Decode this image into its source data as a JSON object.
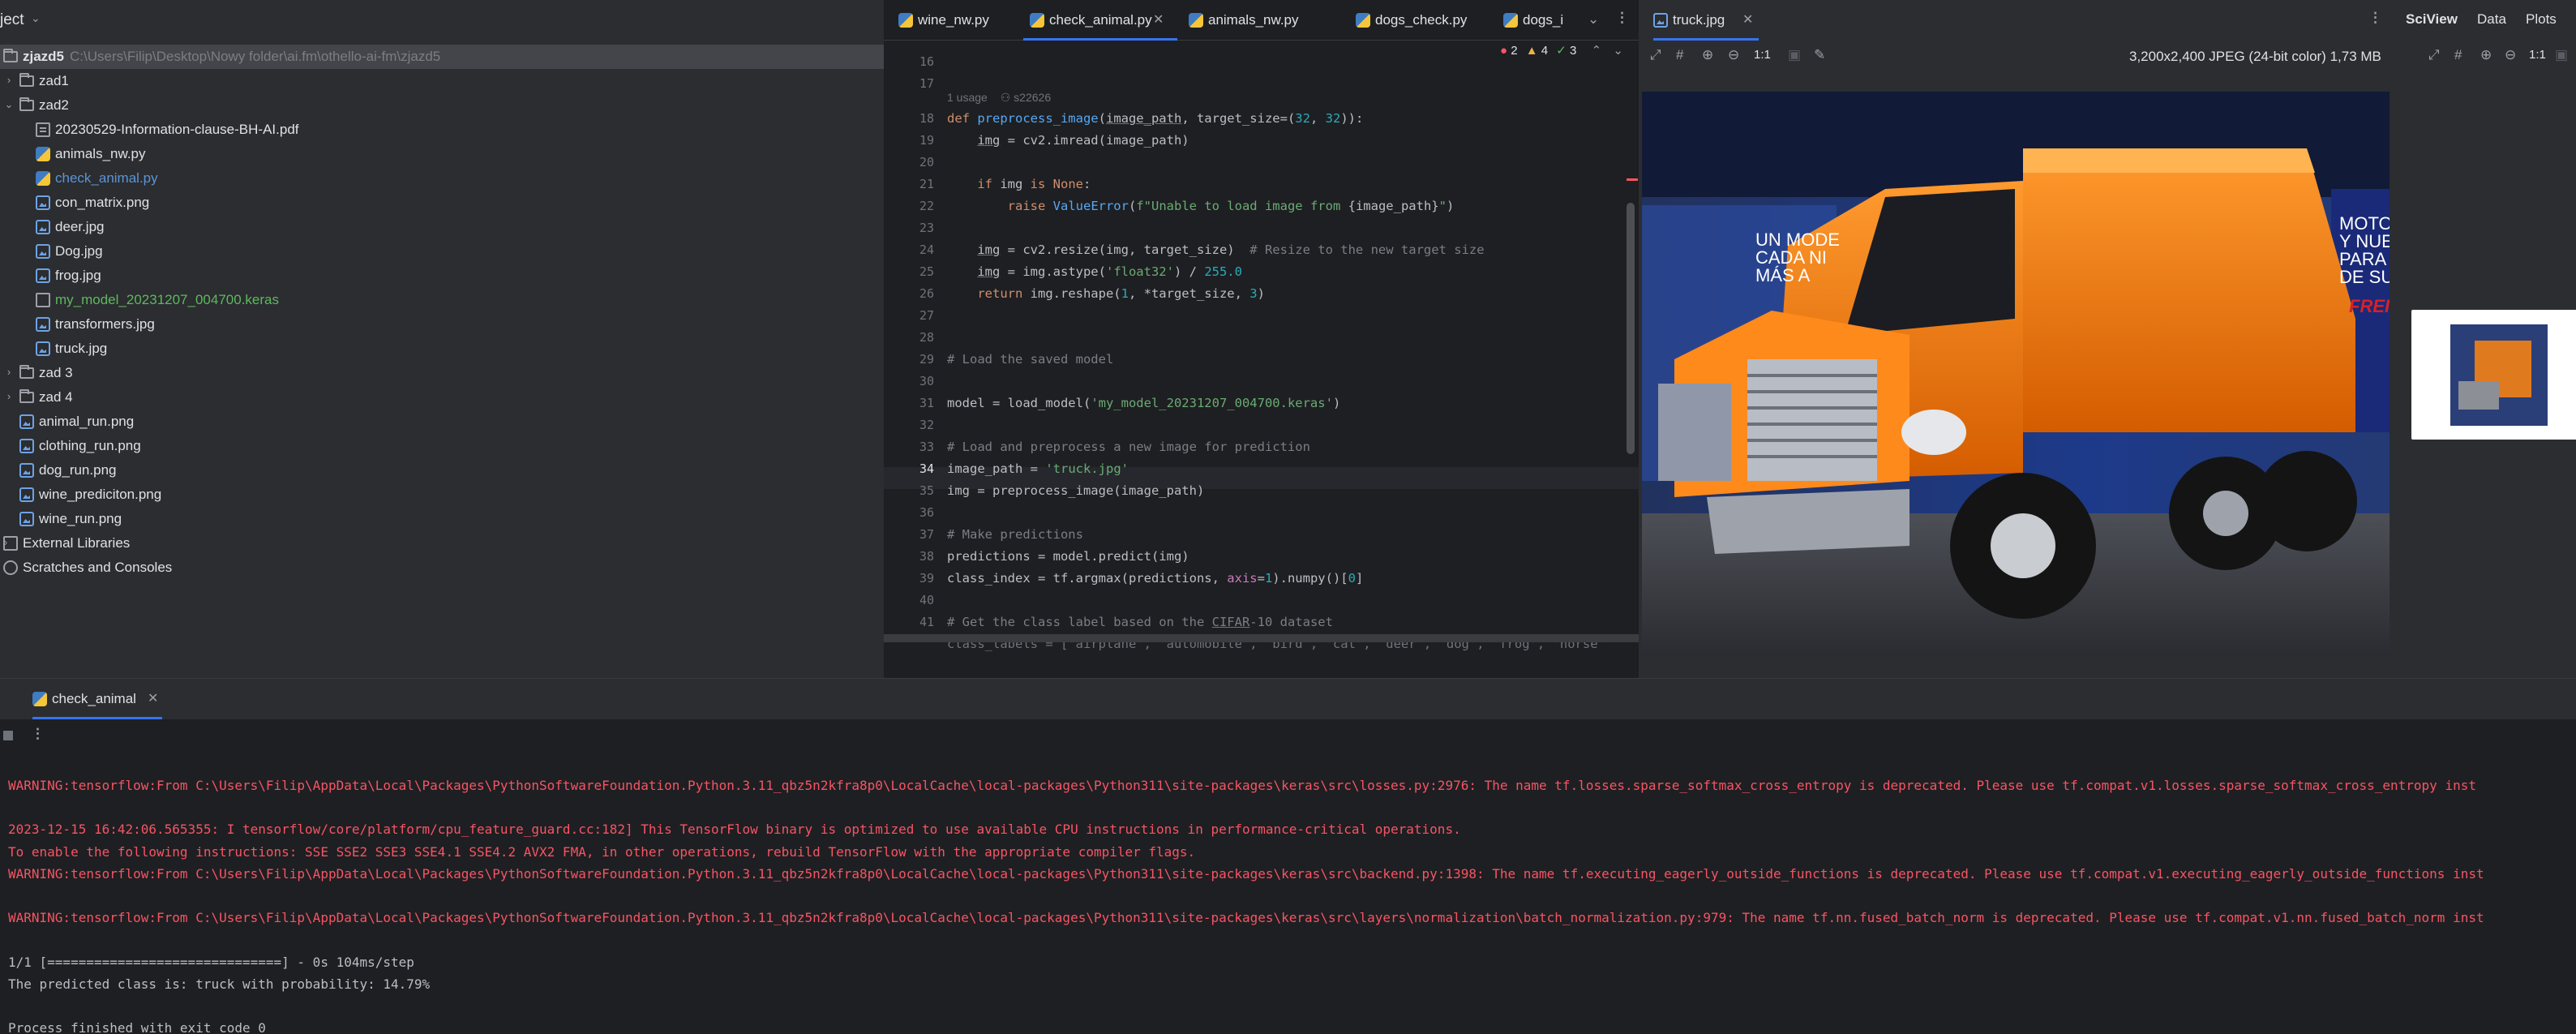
{
  "project": {
    "title": "ject",
    "root": {
      "name": "zjazd5",
      "path": "C:\\Users\\Filip\\Desktop\\Nowy folder\\ai.fm\\othello-ai-fm\\zjazd5"
    },
    "items": [
      {
        "label": "zad1",
        "type": "folder",
        "depth": 1,
        "expanded": false
      },
      {
        "label": "zad2",
        "type": "folder",
        "depth": 1,
        "expanded": true
      },
      {
        "label": "20230529-Information-clause-BH-AI.pdf",
        "type": "pdf",
        "depth": 2
      },
      {
        "label": "animals_nw.py",
        "type": "py",
        "depth": 2
      },
      {
        "label": "check_animal.py",
        "type": "py",
        "depth": 2,
        "color": "#5c94d6"
      },
      {
        "label": "con_matrix.png",
        "type": "img",
        "depth": 2
      },
      {
        "label": "deer.jpg",
        "type": "img",
        "depth": 2
      },
      {
        "label": "Dog.jpg",
        "type": "img",
        "depth": 2
      },
      {
        "label": "frog.jpg",
        "type": "img",
        "depth": 2
      },
      {
        "label": "my_model_20231207_004700.keras",
        "type": "keras",
        "depth": 2,
        "color": "#5fb85f"
      },
      {
        "label": "transformers.jpg",
        "type": "img",
        "depth": 2
      },
      {
        "label": "truck.jpg",
        "type": "img",
        "depth": 2
      },
      {
        "label": "zad 3",
        "type": "folder",
        "depth": 1,
        "expanded": false
      },
      {
        "label": "zad 4",
        "type": "folder",
        "depth": 1,
        "expanded": false
      },
      {
        "label": "animal_run.png",
        "type": "img",
        "depth": 1
      },
      {
        "label": "clothing_run.png",
        "type": "img",
        "depth": 1
      },
      {
        "label": "dog_run.png",
        "type": "img",
        "depth": 1
      },
      {
        "label": "wine_prediciton.png",
        "type": "img",
        "depth": 1
      },
      {
        "label": "wine_run.png",
        "type": "img",
        "depth": 1
      },
      {
        "label": "External Libraries",
        "type": "lib",
        "depth": 0
      },
      {
        "label": "Scratches and Consoles",
        "type": "scr",
        "depth": 0
      }
    ]
  },
  "editor": {
    "tabs": [
      {
        "label": "wine_nw.py",
        "active": false
      },
      {
        "label": "check_animal.py",
        "active": true
      },
      {
        "label": "animals_nw.py",
        "active": false
      },
      {
        "label": "dogs_check.py",
        "active": false
      },
      {
        "label": "dogs_i",
        "active": false
      }
    ],
    "inspection": {
      "errors": "2",
      "warnings": "4",
      "ok": "3"
    },
    "usage": {
      "count": "1 usage",
      "author": "s22626"
    },
    "line_numbers": [
      "16",
      "17",
      "18",
      "19",
      "20",
      "21",
      "22",
      "23",
      "24",
      "25",
      "26",
      "27",
      "28",
      "29",
      "30",
      "31",
      "32",
      "33",
      "34",
      "35",
      "36",
      "37",
      "38",
      "39",
      "40",
      "41"
    ],
    "current_line": "34"
  },
  "viewer": {
    "tab": "truck.jpg",
    "info": "3,200x2,400 JPEG (24-bit color) 1,73 MB",
    "zoom": "1:1",
    "photo_text": {
      "banner_left": "UN MODE\nCADA NI\nMÁS A",
      "banner_right": "MOTOR\nY NUEV\nPARA L\nDE SU I",
      "brand": "FREI"
    }
  },
  "sciview": {
    "tabs": [
      "SciView",
      "Data",
      "Plots"
    ],
    "zoom": "1:1"
  },
  "run": {
    "tab": "check_animal",
    "lines": [
      {
        "kind": "warn",
        "text": "WARNING:tensorflow:From C:\\Users\\Filip\\AppData\\Local\\Packages\\PythonSoftwareFoundation.Python.3.11_qbz5n2kfra8p0\\LocalCache\\local-packages\\Python311\\site-packages\\keras\\src\\losses.py:2976: The name tf.losses.sparse_softmax_cross_entropy is deprecated. Please use tf.compat.v1.losses.sparse_softmax_cross_entropy inst"
      },
      {
        "kind": "blank",
        "text": ""
      },
      {
        "kind": "warn",
        "text": "2023-12-15 16:42:06.565355: I tensorflow/core/platform/cpu_feature_guard.cc:182] This TensorFlow binary is optimized to use available CPU instructions in performance-critical operations."
      },
      {
        "kind": "warn",
        "text": "To enable the following instructions: SSE SSE2 SSE3 SSE4.1 SSE4.2 AVX2 FMA, in other operations, rebuild TensorFlow with the appropriate compiler flags."
      },
      {
        "kind": "warn",
        "text": "WARNING:tensorflow:From C:\\Users\\Filip\\AppData\\Local\\Packages\\PythonSoftwareFoundation.Python.3.11_qbz5n2kfra8p0\\LocalCache\\local-packages\\Python311\\site-packages\\keras\\src\\backend.py:1398: The name tf.executing_eagerly_outside_functions is deprecated. Please use tf.compat.v1.executing_eagerly_outside_functions inst"
      },
      {
        "kind": "blank",
        "text": ""
      },
      {
        "kind": "warn",
        "text": "WARNING:tensorflow:From C:\\Users\\Filip\\AppData\\Local\\Packages\\PythonSoftwareFoundation.Python.3.11_qbz5n2kfra8p0\\LocalCache\\local-packages\\Python311\\site-packages\\keras\\src\\layers\\normalization\\batch_normalization.py:979: The name tf.nn.fused_batch_norm is deprecated. Please use tf.compat.v1.nn.fused_batch_norm inst"
      },
      {
        "kind": "blank",
        "text": ""
      },
      {
        "kind": "plain",
        "text": "1/1 [==============================] - 0s 104ms/step"
      },
      {
        "kind": "plain",
        "text": "The predicted class is: truck with probability: 14.79%"
      },
      {
        "kind": "blank",
        "text": ""
      },
      {
        "kind": "plain",
        "text": "Process finished with exit code 0"
      }
    ]
  },
  "colors": {
    "accent": "#3574f0",
    "error": "#f75464",
    "keyword": "#cf8e6d",
    "string": "#6aab73",
    "function": "#56a8f5"
  }
}
